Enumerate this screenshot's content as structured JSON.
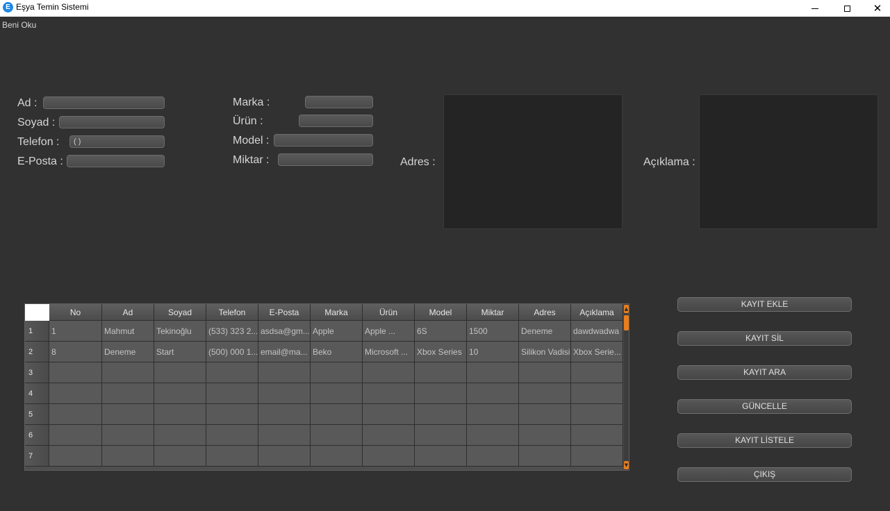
{
  "window": {
    "title": "Eşya Temin Sistemi",
    "icon_letter": "E"
  },
  "menu": {
    "items": [
      "Beni Oku"
    ]
  },
  "form": {
    "ad_label": "Ad :",
    "soyad_label": "Soyad :",
    "telefon_label": "Telefon :",
    "telefon_value": "(   )",
    "eposta_label": "E-Posta :",
    "marka_label": "Marka :",
    "urun_label": "Ürün :",
    "model_label": "Model :",
    "miktar_label": "Miktar :",
    "adres_label": "Adres :",
    "aciklama_label": "Açıklama :"
  },
  "table": {
    "columns": [
      "No",
      "Ad",
      "Soyad",
      "Telefon",
      "E-Posta",
      "Marka",
      "Ürün",
      "Model",
      "Miktar",
      "Adres",
      "Açıklama"
    ],
    "row_numbers": [
      "1",
      "2",
      "3",
      "4",
      "5",
      "6",
      "7"
    ],
    "rows": [
      [
        "1",
        "Mahmut",
        "Tekinoğlu",
        "(533) 323 2...",
        "asdsa@gm...",
        "Apple",
        "Apple ...",
        "6S",
        "1500",
        "Deneme",
        "dawdwadwa"
      ],
      [
        "8",
        "Deneme",
        "Start",
        "(500) 000 1...",
        "email@ma...",
        "Beko",
        "Microsoft ...",
        "Xbox Series",
        "10",
        "Silikon Vadisi",
        "Xbox Serie..."
      ],
      [
        "",
        "",
        "",
        "",
        "",
        "",
        "",
        "",
        "",
        "",
        ""
      ],
      [
        "",
        "",
        "",
        "",
        "",
        "",
        "",
        "",
        "",
        "",
        ""
      ],
      [
        "",
        "",
        "",
        "",
        "",
        "",
        "",
        "",
        "",
        "",
        ""
      ],
      [
        "",
        "",
        "",
        "",
        "",
        "",
        "",
        "",
        "",
        "",
        ""
      ],
      [
        "",
        "",
        "",
        "",
        "",
        "",
        "",
        "",
        "",
        "",
        ""
      ]
    ]
  },
  "buttons": {
    "kayit_ekle": "KAYIT EKLE",
    "kayit_sil": "KAYIT SİL",
    "kayit_ara": "KAYIT ARA",
    "guncelle": "GÜNCELLE",
    "kayit_listele": "KAYIT LİSTELE",
    "cikis": "ÇIKIŞ"
  },
  "colors": {
    "background": "#313131",
    "scrollbar_accent": "#e87e1e"
  }
}
